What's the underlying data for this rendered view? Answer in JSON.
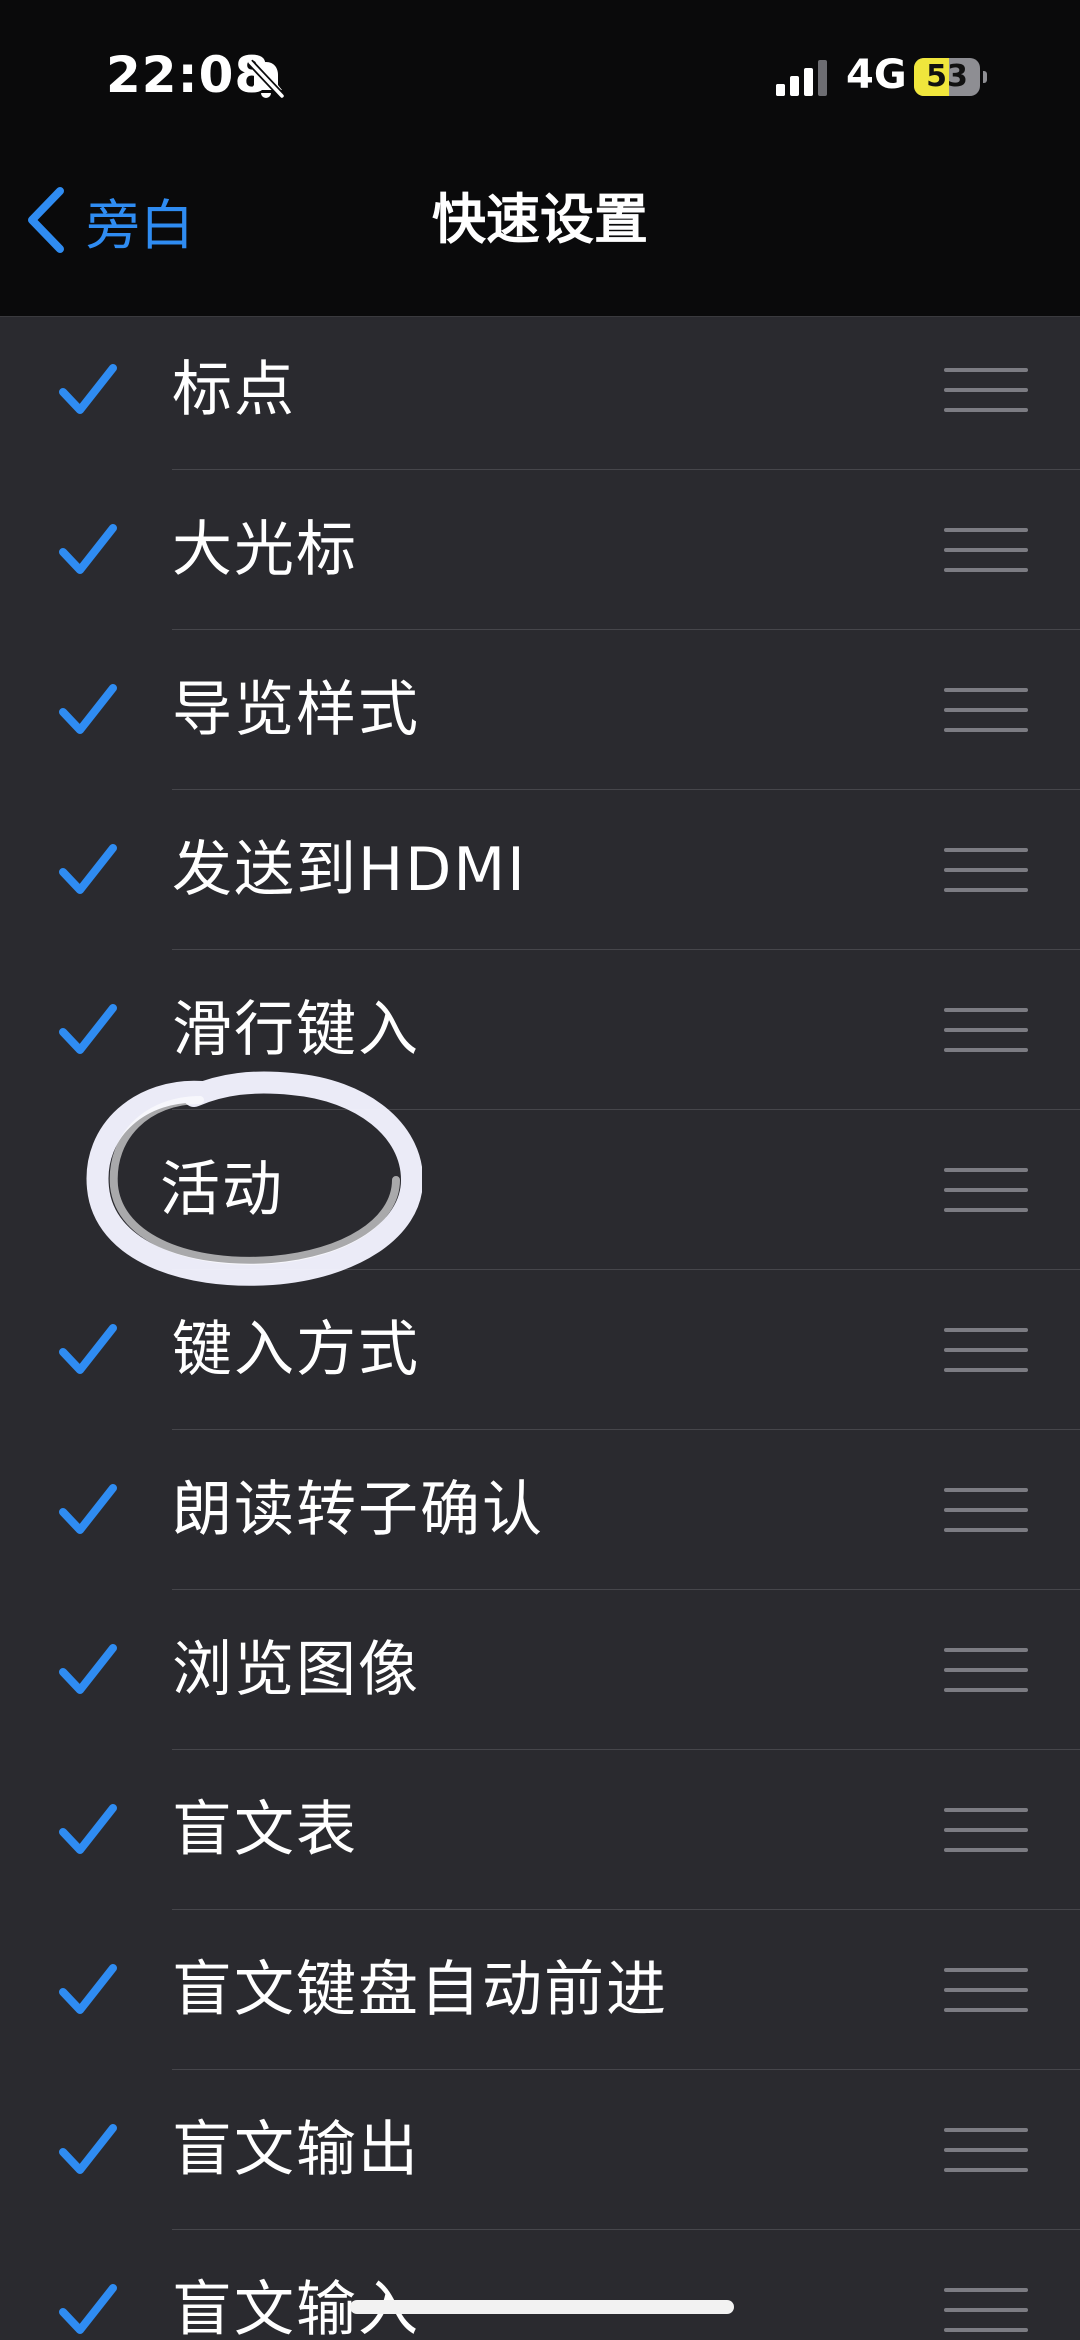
{
  "status_bar": {
    "time": "22:08",
    "network": "4G",
    "battery_level": "53",
    "battery_fraction": 0.53
  },
  "nav": {
    "back_label": "旁白",
    "title": "快速设置"
  },
  "colors": {
    "accent": "#2f8cf2",
    "background": "#2a2a2f",
    "topbar": "#0a0a0b",
    "separator": "#46464b",
    "handle": "#7c7c83",
    "battery_fill": "#f0e63c",
    "annotation": "#f4f4ff"
  },
  "items": [
    {
      "label": "标点",
      "checked": true
    },
    {
      "label": "大光标",
      "checked": true
    },
    {
      "label": "导览样式",
      "checked": true
    },
    {
      "label": "发送到HDMI",
      "checked": true
    },
    {
      "label": "滑行键入",
      "checked": true
    },
    {
      "label": "活动",
      "checked": false
    },
    {
      "label": "键入方式",
      "checked": true
    },
    {
      "label": "朗读转子确认",
      "checked": true
    },
    {
      "label": "浏览图像",
      "checked": true
    },
    {
      "label": "盲文表",
      "checked": true
    },
    {
      "label": "盲文键盘自动前进",
      "checked": true
    },
    {
      "label": "盲文输出",
      "checked": true
    },
    {
      "label": "盲文输入",
      "checked": true
    }
  ],
  "icons": {
    "check": "checkmark-icon",
    "reorder": "reorder-handle-icon",
    "back": "chevron-left-icon",
    "mute": "bell-slash-icon",
    "signal": "cellular-signal-icon"
  }
}
